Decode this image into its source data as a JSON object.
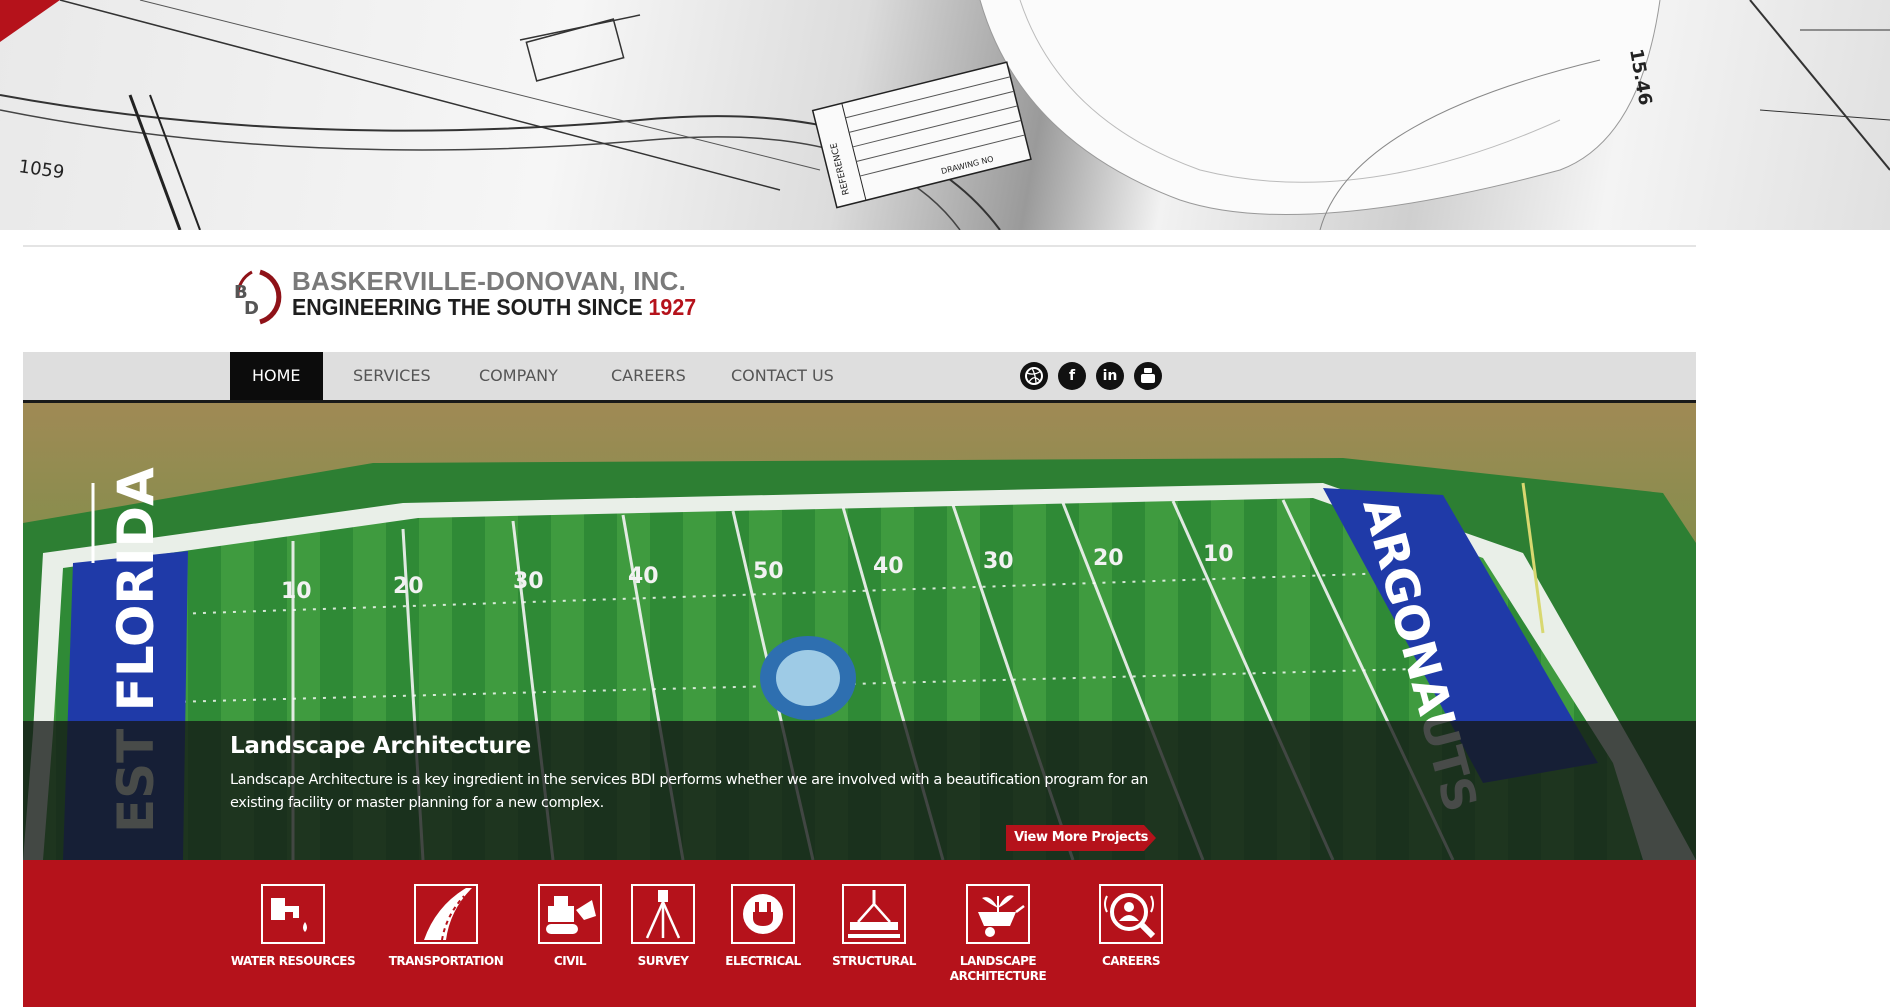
{
  "banner": {
    "corner_color": "#b5121b",
    "sketch_labels": [
      "1059",
      "15.46",
      "REFERENCE",
      "DRAWING NO"
    ]
  },
  "logo": {
    "company_name": "BASKERVILLE-DONOVAN, INC.",
    "tagline_prefix": "ENGINEERING THE SOUTH SINCE",
    "tagline_year": "1927",
    "monogram": "BD"
  },
  "nav": {
    "items": [
      {
        "label": "HOME",
        "active": true
      },
      {
        "label": "SERVICES",
        "active": false
      },
      {
        "label": "COMPANY",
        "active": false
      },
      {
        "label": "CAREERS",
        "active": false
      },
      {
        "label": "CONTACT US",
        "active": false
      }
    ],
    "social": [
      "dribbble-icon",
      "facebook-icon",
      "linkedin-icon",
      "youtube-icon"
    ]
  },
  "slide": {
    "title": "Landscape Architecture",
    "text": "Landscape Architecture is a key ingredient in the services BDI performs whether we are involved with a beautification program for an existing facility or master planning for a new complex.",
    "button": "View More Projects",
    "endzone_left": "EST FLORIDA",
    "endzone_right": "ARGONAUTS",
    "yard_numbers": [
      "10",
      "20",
      "30",
      "40",
      "50",
      "40",
      "30",
      "20",
      "10"
    ]
  },
  "services": {
    "items": [
      {
        "label": "WATER RESOURCES",
        "icon": "faucet-icon"
      },
      {
        "label": "TRANSPORTATION",
        "icon": "road-icon"
      },
      {
        "label": "CIVIL",
        "icon": "bulldozer-icon"
      },
      {
        "label": "SURVEY",
        "icon": "tripod-icon"
      },
      {
        "label": "ELECTRICAL",
        "icon": "plug-icon"
      },
      {
        "label": "STRUCTURAL",
        "icon": "crane-beam-icon"
      },
      {
        "label": "LANDSCAPE\nARCHITECTURE",
        "icon": "wheelbarrow-plant-icon"
      },
      {
        "label": "CAREERS",
        "icon": "person-search-icon"
      }
    ]
  },
  "colors": {
    "brand_red": "#b5121b",
    "nav_bg": "#dedede",
    "nav_active": "#0c0c0c",
    "turf_green": "#2f8a36",
    "endzone_blue": "#1f3aa8"
  }
}
